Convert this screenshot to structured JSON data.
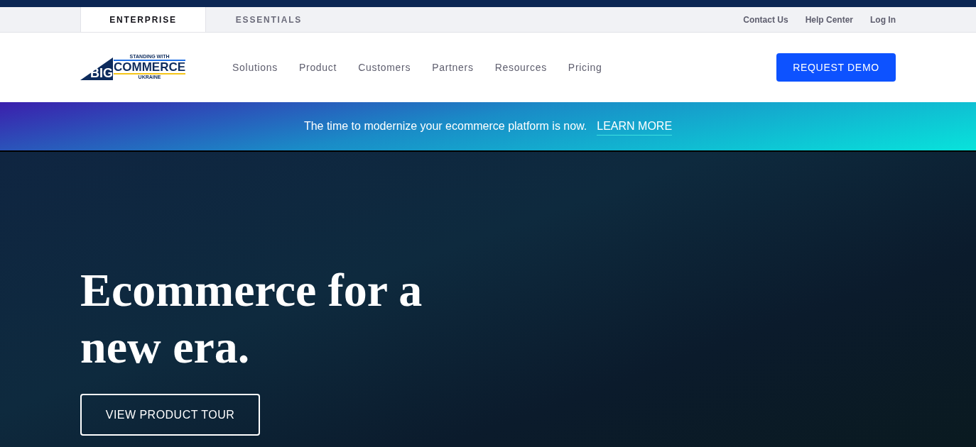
{
  "site_tabs": [
    {
      "label": "ENTERPRISE",
      "selected": true
    },
    {
      "label": "ESSENTIALS",
      "selected": false
    }
  ],
  "utility_links": [
    "Contact Us",
    "Help Center",
    "Log In"
  ],
  "logo": {
    "wordmark_left": "BIG",
    "wordmark_right": "COMMERCE",
    "top_line": "STANDING WITH",
    "bottom_line": "UKRAINE"
  },
  "nav": [
    "Solutions",
    "Product",
    "Customers",
    "Partners",
    "Resources",
    "Pricing"
  ],
  "cta": "REQUEST DEMO",
  "banner": {
    "text": "The time to modernize your ecommerce platform is now.",
    "link": "LEARN MORE"
  },
  "hero": {
    "headline_lines": [
      "Ecommerce for a",
      "new era."
    ],
    "button": "VIEW PRODUCT TOUR"
  }
}
